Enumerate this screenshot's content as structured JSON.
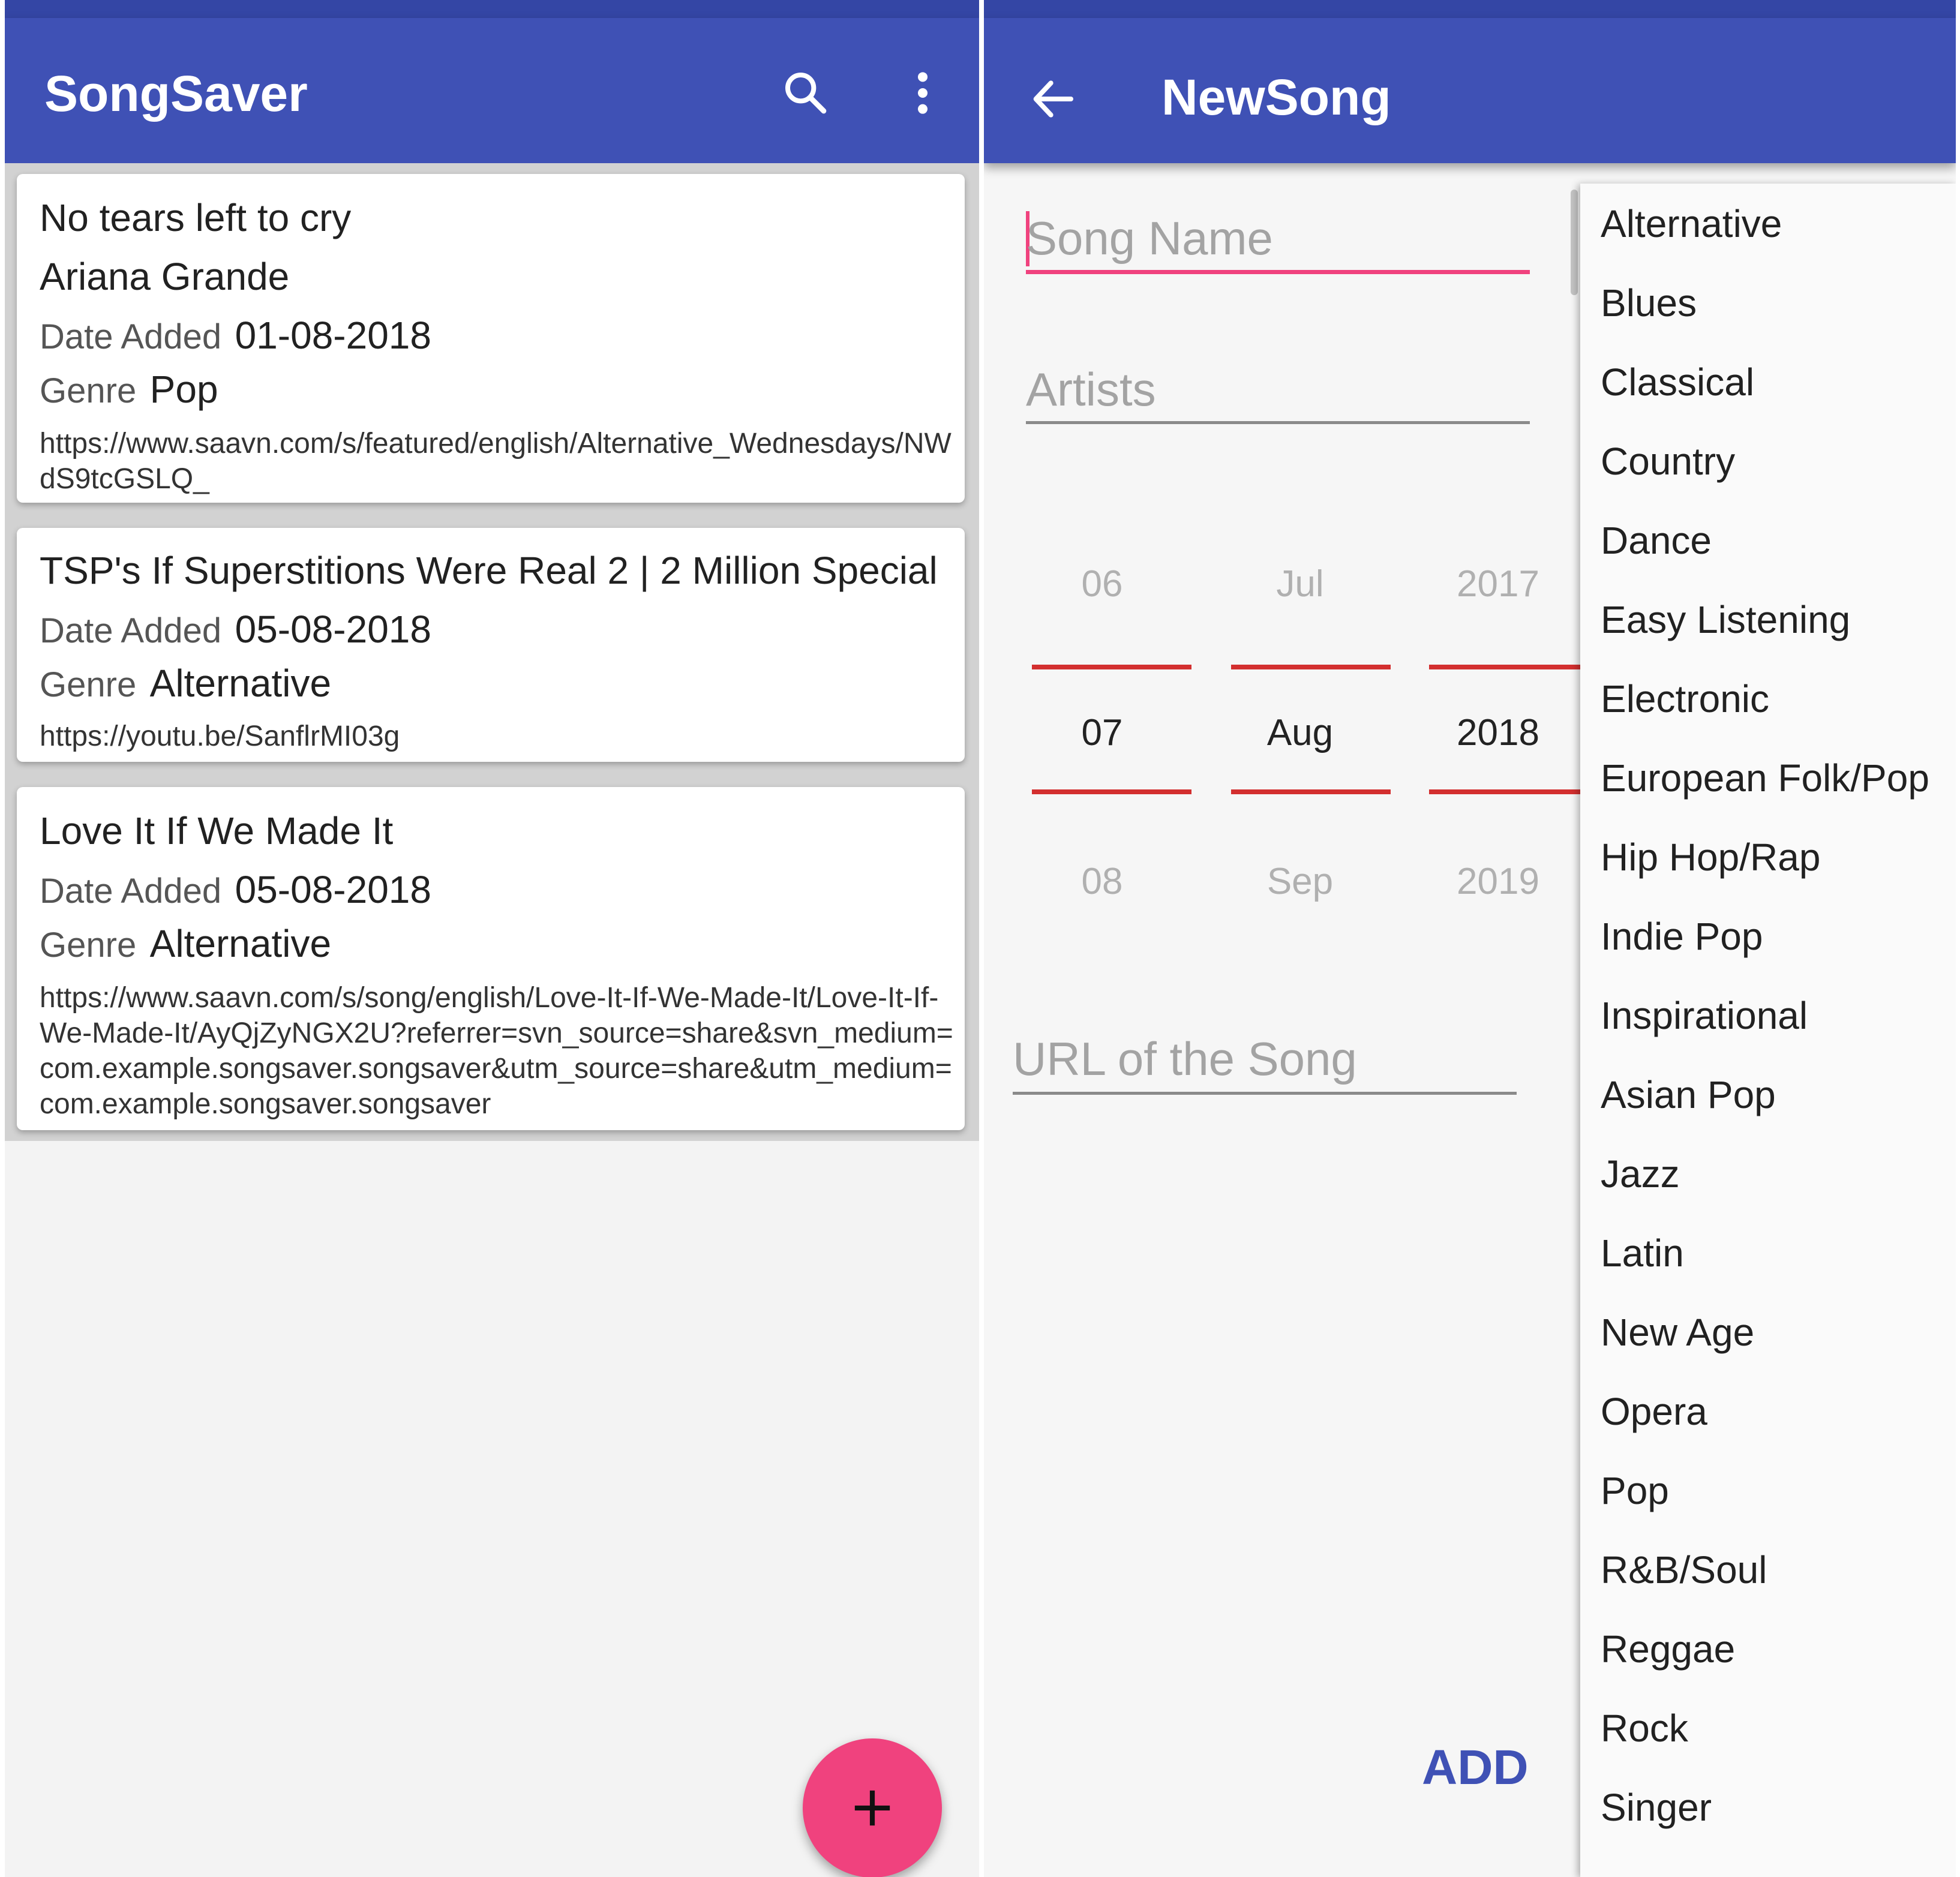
{
  "left": {
    "app_title": "SongSaver",
    "search_icon": "search-icon",
    "menu_icon": "more-vert-icon",
    "songs": [
      {
        "title": "No tears left to cry",
        "artist": "Ariana Grande",
        "date_label": "Date Added",
        "date": "01-08-2018",
        "genre_label": "Genre",
        "genre": "Pop",
        "url": "https://www.saavn.com/s/featured/english/Alternative_Wednesdays/NWdS9tcGSLQ_"
      },
      {
        "title": "TSP's If Superstitions Were Real 2 | 2 Million Special",
        "date_label": "Date Added",
        "date": "05-08-2018",
        "genre_label": "Genre",
        "genre": "Alternative",
        "url": "https://youtu.be/SanflrMI03g"
      },
      {
        "title": "Love It If We Made It",
        "date_label": "Date Added",
        "date": "05-08-2018",
        "genre_label": "Genre",
        "genre": "Alternative",
        "url": "https://www.saavn.com/s/song/english/Love-It-If-We-Made-It/Love-It-If-We-Made-It/AyQjZyNGX2U?referrer=svn_source=share&svn_medium=com.example.songsaver.songsaver&utm_source=share&utm_medium=com.example.songsaver.songsaver"
      }
    ],
    "fab_label": "+",
    "fab_icon": "add-icon"
  },
  "right": {
    "back_icon": "arrow-back-icon",
    "title": "NewSong",
    "song_name_placeholder": "Song Name",
    "artists_placeholder": "Artists",
    "url_placeholder": "URL of the Song",
    "date_picker": {
      "day": {
        "prev": "06",
        "selected": "07",
        "next": "08"
      },
      "month": {
        "prev": "Jul",
        "selected": "Aug",
        "next": "Sep"
      },
      "year": {
        "prev": "2017",
        "selected": "2018",
        "next": "2019"
      }
    },
    "add_label": "ADD",
    "genres": [
      "Alternative",
      "Blues",
      "Classical",
      "Country",
      "Dance",
      "Easy Listening",
      "Electronic",
      "European Folk/Pop",
      "Hip Hop/Rap",
      "Indie Pop",
      "Inspirational",
      "Asian Pop",
      "Jazz",
      "Latin",
      "New Age",
      "Opera",
      "Pop",
      "R&B/Soul",
      "Reggae",
      "Rock",
      "Singer"
    ]
  },
  "colors": {
    "primary": "#3f51b5",
    "accent": "#f0427e",
    "picker_divider": "#d32f2f"
  }
}
